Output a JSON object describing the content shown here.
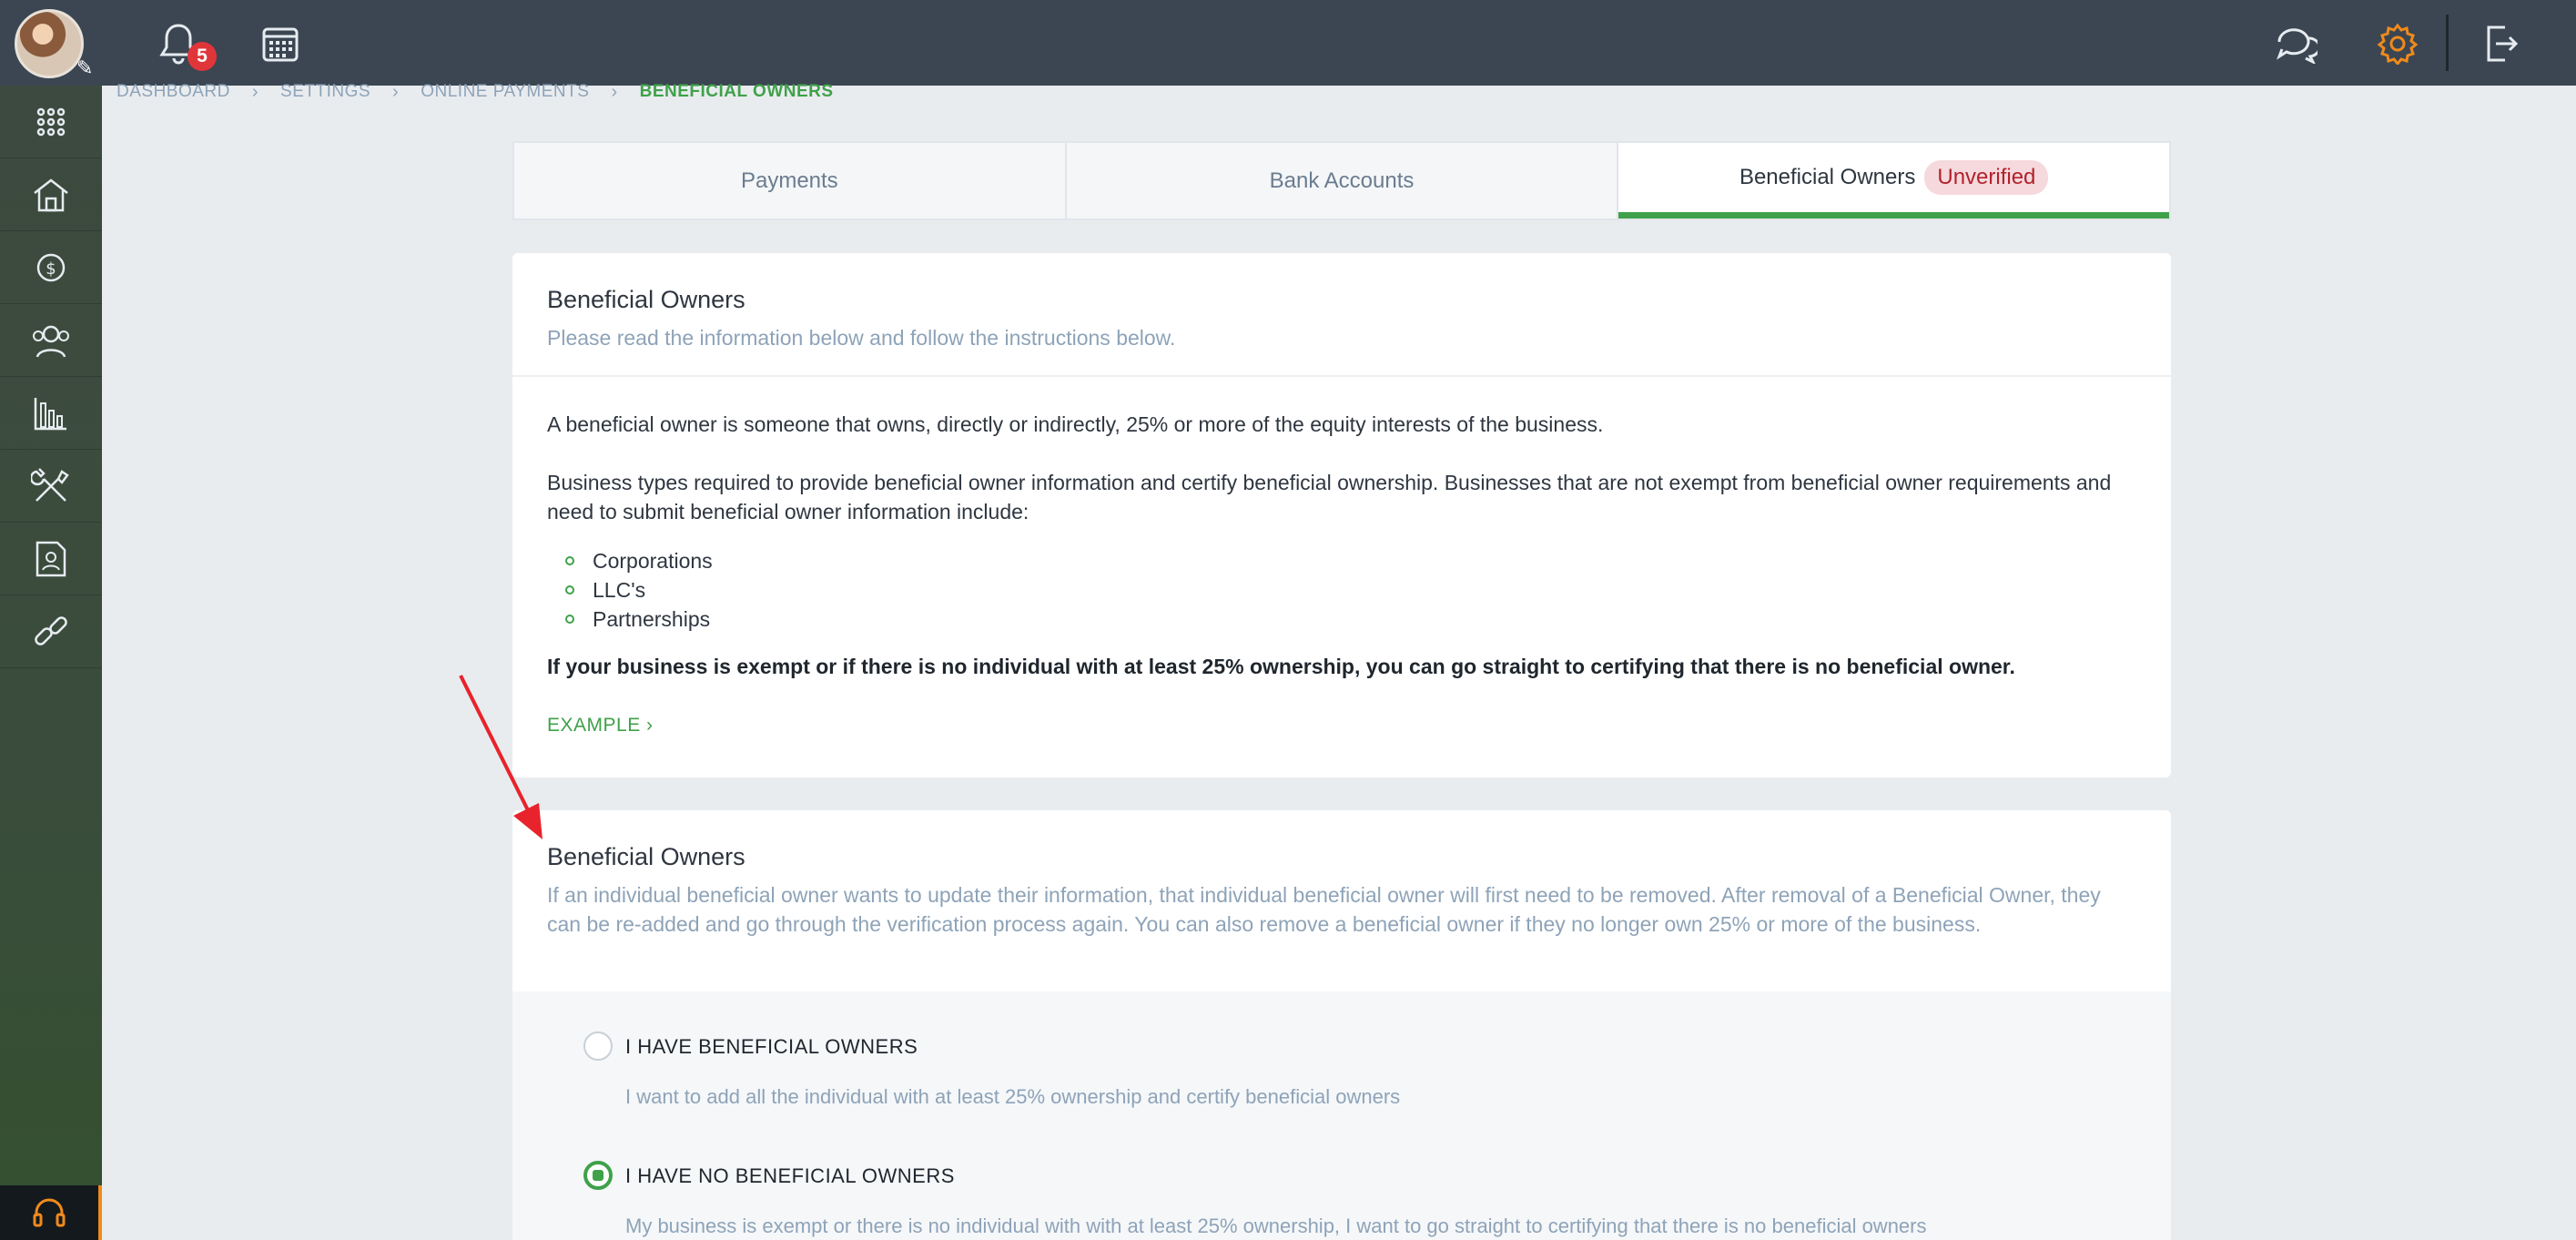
{
  "topbar": {
    "notifications_count": "5",
    "icons": [
      "bell-icon",
      "calendar-icon",
      "chat-icon",
      "settings-icon",
      "logout-icon"
    ]
  },
  "sidebar": {
    "items": [
      "apps-icon",
      "home-icon",
      "payments-icon",
      "contacts-icon",
      "reports-icon",
      "tools-icon",
      "documents-icon",
      "link-icon"
    ],
    "help_icon": "headset-icon"
  },
  "breadcrumb": {
    "items": [
      "DASHBOARD",
      "SETTINGS",
      "ONLINE PAYMENTS",
      "BENEFICIAL OWNERS"
    ]
  },
  "tabs": {
    "items": [
      "Payments",
      "Bank Accounts",
      "Beneficial Owners"
    ],
    "active_badge": "Unverified"
  },
  "info_card": {
    "title": "Beneficial Owners",
    "subtitle": "Please read the information below and follow the instructions below.",
    "para1": "A beneficial owner is someone that owns, directly or indirectly, 25% or more of the equity interests of the business.",
    "para2": "Business types required to provide beneficial owner information and certify beneficial ownership. Businesses that are not exempt from beneficial owner requirements and need to submit beneficial owner information include:",
    "bullets": [
      "Corporations",
      "LLC's",
      "Partnerships"
    ],
    "bold_note": "If your business is exempt or if there is no individual with at least 25% ownership, you can go straight to certifying that there is no beneficial owner.",
    "example_link": "EXAMPLE ›"
  },
  "owners_card": {
    "title": "Beneficial Owners",
    "subtitle": "If an individual beneficial owner wants to update their information, that individual beneficial owner will first need to be removed. After removal of a Beneficial Owner, they can be re-added and go through the verification process again. You can also remove a beneficial owner if they no longer own 25% or more of the business.",
    "options": [
      {
        "label": "I HAVE BENEFICIAL OWNERS",
        "desc": "I want to add all the individual with at least 25% ownership and certify beneficial owners",
        "checked": false
      },
      {
        "label": "I HAVE NO BENEFICIAL OWNERS",
        "desc": "My business is exempt or there is no individual with with at least 25% ownership, I want to go straight to certifying that there is no beneficial owners",
        "checked": true
      }
    ]
  },
  "colors": {
    "topbar": "#3b4652",
    "accent_green": "#3fa14a",
    "settings_orange": "#f08a1c",
    "badge_red": "#e0363a",
    "unverified_bg": "#f6d9dc",
    "annotation_arrow": "#e8232b"
  }
}
